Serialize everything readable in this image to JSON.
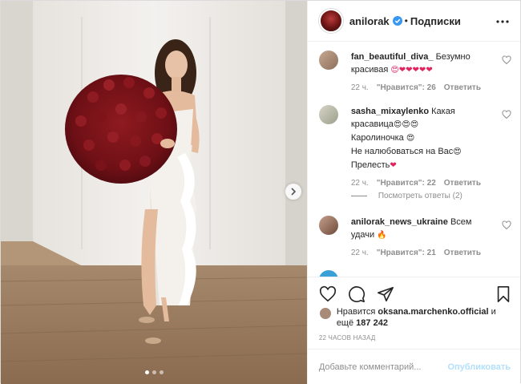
{
  "header": {
    "username": "anilorak",
    "separator": "•",
    "follow_label": "Подписки"
  },
  "comments": [
    {
      "username": "fan_beautiful_diva_",
      "text": "Безумно красивая",
      "emoji": "😍❤❤❤❤❤",
      "time": "22 ч.",
      "likes": "\"Нравится\": 26",
      "reply": "Ответить"
    },
    {
      "username": "sasha_mixaylenko",
      "text": "Какая красавица",
      "emoji": "😍😍😍",
      "line2": "Каролиночка",
      "line2_emoji": "😍",
      "line3": "Не налюбоваться на Вас",
      "line3_emoji": "😍",
      "line4": "Прелесть",
      "line4_emoji": "❤",
      "time": "22 ч.",
      "likes": "\"Нравится\": 22",
      "reply": "Ответить"
    },
    {
      "username": "anilorak_news_ukraine",
      "text": "Всем удачи",
      "emoji": "🔥",
      "time": "22 ч.",
      "likes": "\"Нравится\": 21",
      "reply": "Ответить"
    }
  ],
  "view_replies": "Посмотреть ответы (2)",
  "likes_info": {
    "prefix": "Нравится",
    "user": "oksana.marchenko.official",
    "middle": "и",
    "count_prefix": "ещё",
    "count": "187 242"
  },
  "timestamp": "22 ЧАСОВ НАЗАД",
  "add_comment": {
    "placeholder": "Добавьте комментарий...",
    "publish_label": "Опубликовать"
  },
  "carousel": {
    "slides": 3,
    "active": 1
  },
  "icons": [
    "verified-icon",
    "more-icon",
    "heart-icon",
    "comment-icon",
    "share-icon",
    "save-icon",
    "chevron-right-icon"
  ],
  "colors": {
    "accent_disabled": "#b2dffc",
    "secondary_text": "#8e8e8e",
    "verified": "#3897f0"
  }
}
